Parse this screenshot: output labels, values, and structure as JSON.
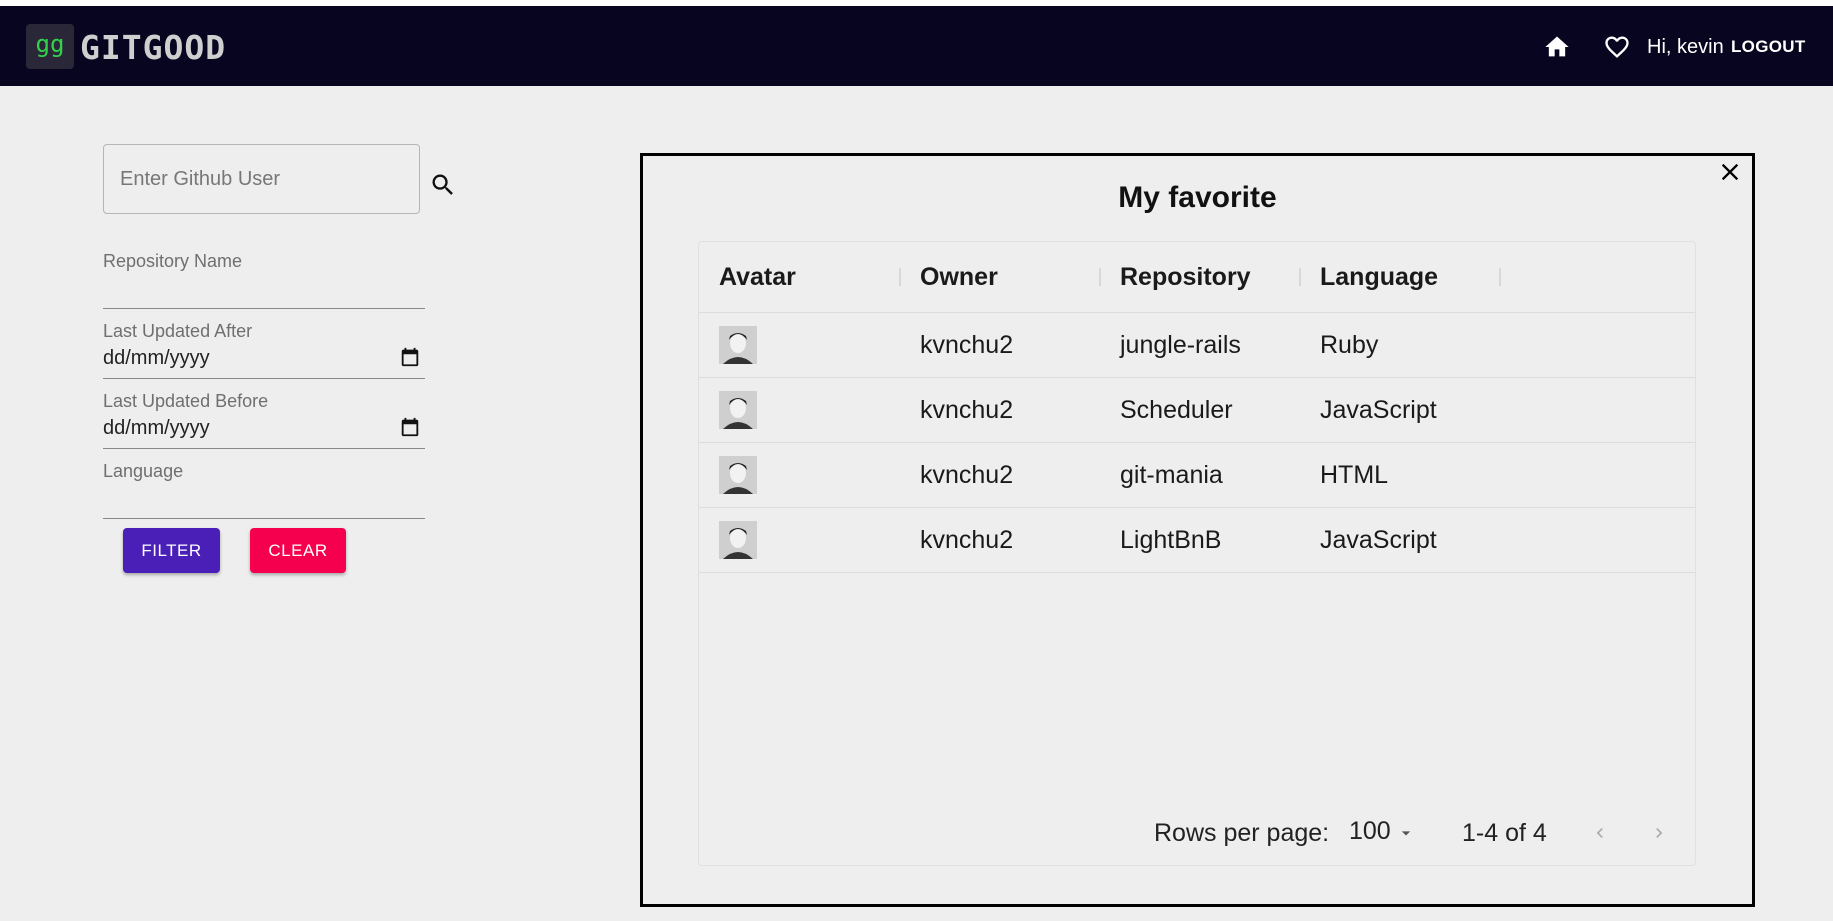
{
  "header": {
    "logo_mark": "gg",
    "app_name": "GITGOOD",
    "greeting": "Hi, kevin",
    "logout_label": "LOGOUT"
  },
  "filters": {
    "search_placeholder": "Enter Github User",
    "repo_name_label": "Repository Name",
    "updated_after_label": "Last Updated After",
    "updated_after_value": "dd/mm/yyyy",
    "updated_before_label": "Last Updated Before",
    "updated_before_value": "dd/mm/yyyy",
    "language_label": "Language",
    "filter_label": "FILTER",
    "clear_label": "CLEAR"
  },
  "modal": {
    "title": "My favorite",
    "columns": [
      "Avatar",
      "Owner",
      "Repository",
      "Language"
    ],
    "rows": [
      {
        "owner": "kvnchu2",
        "repository": "jungle-rails",
        "language": "Ruby"
      },
      {
        "owner": "kvnchu2",
        "repository": "Scheduler",
        "language": "JavaScript"
      },
      {
        "owner": "kvnchu2",
        "repository": "git-mania",
        "language": "HTML"
      },
      {
        "owner": "kvnchu2",
        "repository": "LightBnB",
        "language": "JavaScript"
      }
    ],
    "footer": {
      "rows_per_page_label": "Rows per page:",
      "rows_per_page_value": "100",
      "range": "1-4 of 4"
    }
  },
  "colors": {
    "appbar": "#07051f",
    "logo_green": "#33d24a",
    "filter_button": "#4a1fb8",
    "clear_button": "#f5004f",
    "background": "#eeeeee"
  },
  "icons": [
    "home-icon",
    "heart-icon",
    "search-icon",
    "calendar-icon",
    "close-icon",
    "dropdown-arrow-icon",
    "chevron-left-icon",
    "chevron-right-icon"
  ]
}
